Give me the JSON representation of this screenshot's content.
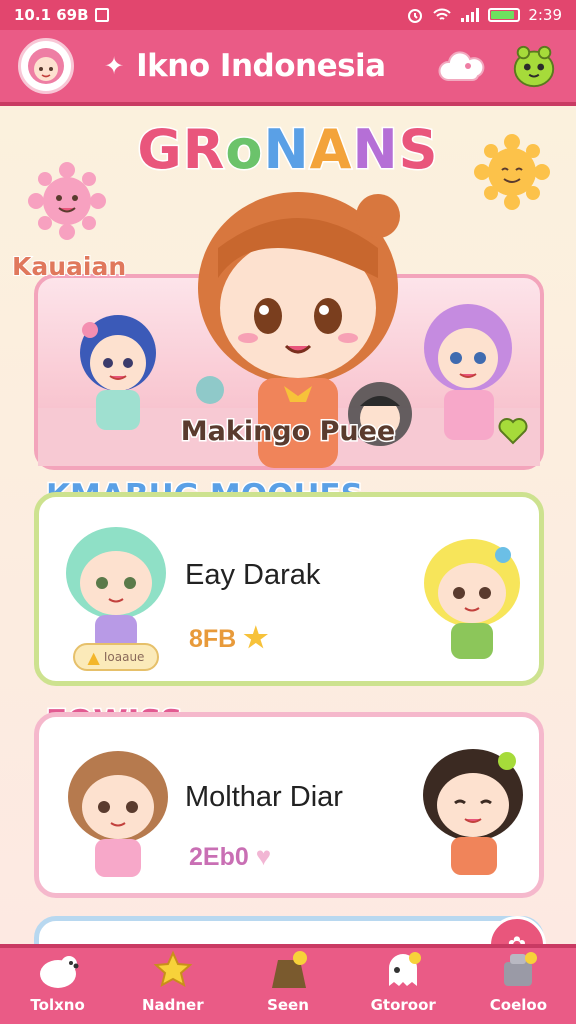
{
  "status_bar": {
    "time_left": "10.1 69B",
    "time_right": "2:39"
  },
  "app_bar": {
    "title": "Ikno Indonesia"
  },
  "banner": {
    "logo": [
      "G",
      "R",
      "o",
      "N",
      "A",
      "N",
      "S"
    ],
    "logo_colors": [
      "#e9567c",
      "#e9567c",
      "#6bc36b",
      "#5aa0e6",
      "#f3a33a",
      "#b56fd6",
      "#e9567c"
    ],
    "tag": "Kauaian",
    "caption": "Makingo Puee"
  },
  "section1": {
    "title": "KMABUG MOOHES",
    "title_color": "#5aa0e6",
    "title_color2": "#f3974a",
    "card": {
      "name": "Eay Darak",
      "score": "8FB",
      "badge": "Ioaaue",
      "score_color": "#e89a3a"
    }
  },
  "section2": {
    "title": "EOWISS",
    "title_color": "#e25a91",
    "card": {
      "name": "Molthar Diar",
      "score": "2Eb0",
      "score_color": "#c96fb4"
    }
  },
  "nav": [
    {
      "label": "Tolxno"
    },
    {
      "label": "Nadner"
    },
    {
      "label": "Seen"
    },
    {
      "label": "Gtoroor"
    },
    {
      "label": "Coeloo"
    }
  ]
}
